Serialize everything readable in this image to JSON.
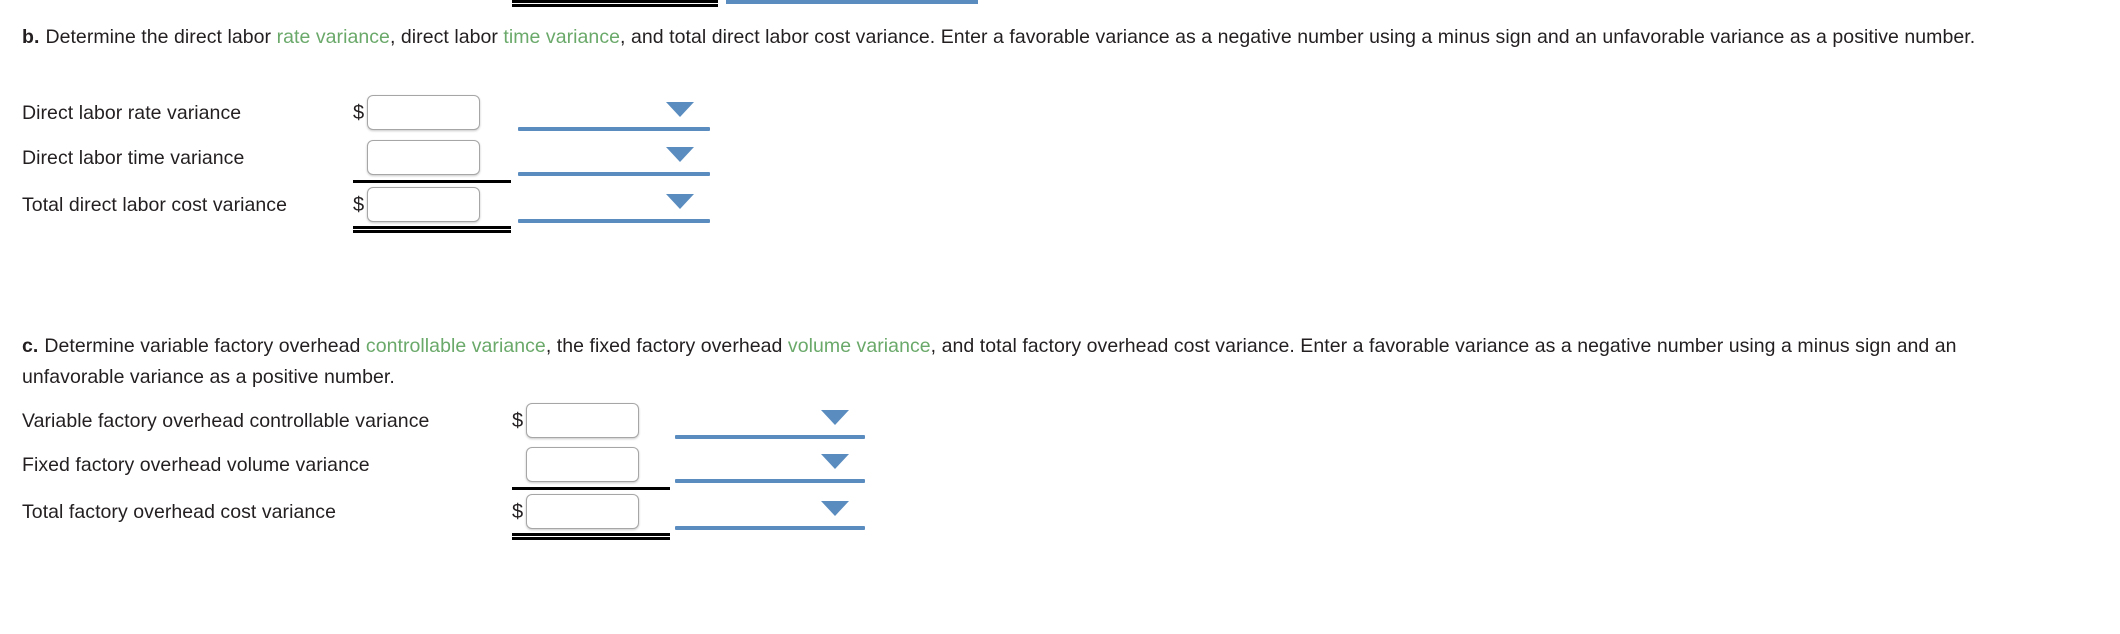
{
  "top_clipped_artifacts": {
    "double_rule_present": true,
    "blue_select_line_present": true
  },
  "accent_colors": {
    "term_green": "#6aa96a",
    "select_blue": "#5a8cc0",
    "rule_black": "#000000",
    "input_border_gray": "#a6a6a6",
    "text": "#231f20"
  },
  "sections": [
    {
      "marker": "b.",
      "prompt_parts": [
        {
          "text": "Determine the direct labor ",
          "style": "plain"
        },
        {
          "text": "rate variance",
          "style": "term"
        },
        {
          "text": ", direct labor ",
          "style": "plain"
        },
        {
          "text": "time variance",
          "style": "term"
        },
        {
          "text": ", and total direct labor cost variance. Enter a favorable variance as a negative number using a minus sign and an unfavorable variance as a positive number.",
          "style": "plain"
        }
      ],
      "rows": [
        {
          "label": "Direct labor rate variance",
          "currency": "$",
          "input_value": "",
          "input_placeholder": "",
          "rule": "none",
          "select_value": ""
        },
        {
          "label": "Direct labor time variance",
          "currency": "",
          "input_value": "",
          "input_placeholder": "",
          "rule": "single",
          "select_value": ""
        },
        {
          "label": "Total direct labor cost variance",
          "currency": "$",
          "input_value": "",
          "input_placeholder": "",
          "rule": "double",
          "select_value": ""
        }
      ]
    },
    {
      "marker": "c.",
      "prompt_parts": [
        {
          "text": "Determine variable factory overhead ",
          "style": "plain"
        },
        {
          "text": "controllable variance",
          "style": "term"
        },
        {
          "text": ", the fixed factory overhead ",
          "style": "plain"
        },
        {
          "text": "volume variance",
          "style": "term"
        },
        {
          "text": ", and total factory overhead cost variance. Enter a favorable variance as a negative number using a minus sign and an unfavorable variance as a positive number.",
          "style": "plain"
        }
      ],
      "rows": [
        {
          "label": "Variable factory overhead controllable variance",
          "currency": "$",
          "input_value": "",
          "input_placeholder": "",
          "rule": "none",
          "select_value": ""
        },
        {
          "label": "Fixed factory overhead volume variance",
          "currency": "",
          "input_value": "",
          "input_placeholder": "",
          "rule": "single",
          "select_value": ""
        },
        {
          "label": "Total factory overhead cost variance",
          "currency": "$",
          "input_value": "",
          "input_placeholder": "",
          "rule": "double",
          "select_value": ""
        }
      ]
    }
  ]
}
